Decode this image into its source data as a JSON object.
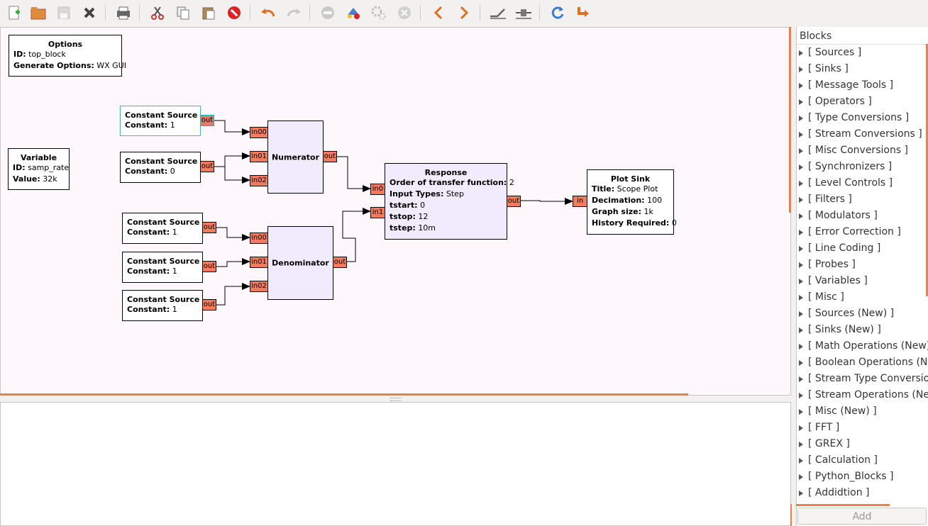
{
  "toolbar": {
    "icons": [
      "new-icon",
      "open-icon",
      "save-icon",
      "close-icon",
      "print-icon",
      "cut-icon",
      "copy-icon",
      "paste-icon",
      "delete-icon",
      "undo-icon",
      "redo-icon",
      "disable-icon",
      "generate-icon",
      "execute-icon",
      "kill-icon",
      "rotate-ccw-icon",
      "rotate-cw-icon",
      "enable-icon",
      "bypass-icon",
      "reload-icon",
      "find-block-icon"
    ]
  },
  "canvas": {
    "options_block": {
      "title": "Options",
      "id_label": "ID:",
      "id_value": "top_block",
      "gen_label": "Generate Options:",
      "gen_value": "WX GUI"
    },
    "variable_block": {
      "title": "Variable",
      "id_label": "ID:",
      "id_value": "samp_rate",
      "val_label": "Value:",
      "val_value": "32k"
    },
    "const_sources": [
      {
        "title": "Constant Source",
        "param_label": "Constant:",
        "param_value": "1",
        "port": "out"
      },
      {
        "title": "Constant Source",
        "param_label": "Constant:",
        "param_value": "0",
        "port": "out"
      },
      {
        "title": "Constant Source",
        "param_label": "Constant:",
        "param_value": "1",
        "port": "out"
      },
      {
        "title": "Constant Source",
        "param_label": "Constant:",
        "param_value": "1",
        "port": "out"
      },
      {
        "title": "Constant Source",
        "param_label": "Constant:",
        "param_value": "1",
        "port": "out"
      }
    ],
    "numerator": {
      "title": "Numerator",
      "in0": "in00",
      "in1": "in01",
      "in2": "in02",
      "out": "out"
    },
    "denominator": {
      "title": "Denominator",
      "in0": "in00",
      "in1": "in01",
      "in2": "in02",
      "out": "out"
    },
    "response": {
      "title": "Response",
      "p1_label": "Order of transfer function:",
      "p1_value": "2",
      "p2_label": "Input Types:",
      "p2_value": "Step",
      "p3_label": "tstart:",
      "p3_value": "0",
      "p4_label": "tstop:",
      "p4_value": "12",
      "p5_label": "tstep:",
      "p5_value": "10m",
      "in0": "in0",
      "in1": "in1",
      "out": "out"
    },
    "plot_sink": {
      "title": "Plot Sink",
      "p1_label": "Title:",
      "p1_value": "Scope Plot",
      "p2_label": "Decimation:",
      "p2_value": "100",
      "p3_label": "Graph size:",
      "p3_value": "1k",
      "p4_label": "History Required:",
      "p4_value": "0",
      "in": "in"
    }
  },
  "blocks_panel": {
    "header": "Blocks",
    "items": [
      "[ Sources ]",
      "[ Sinks ]",
      "[ Message Tools ]",
      "[ Operators ]",
      "[ Type Conversions ]",
      "[ Stream Conversions ]",
      "[ Misc Conversions ]",
      "[ Synchronizers ]",
      "[ Level Controls ]",
      "[ Filters ]",
      "[ Modulators ]",
      "[ Error Correction ]",
      "[ Line Coding ]",
      "[ Probes ]",
      "[ Variables ]",
      "[ Misc ]",
      "[ Sources (New) ]",
      "[ Sinks (New) ]",
      "[ Math Operations (New) ]",
      "[ Boolean Operations (New) ]",
      "[ Stream Type Conversions ]",
      "[ Stream Operations (New) ]",
      "[ Misc (New) ]",
      "[ FFT ]",
      "[ GREX ]",
      "[ Calculation ]",
      "[ Python_Blocks ]",
      "[ Addidtion ]"
    ],
    "add_label": "Add"
  },
  "colors": {
    "port": "#f47b5c",
    "block": "#f1ecfd",
    "canvas": "#fef8fc",
    "accent": "#ef7d4b"
  }
}
